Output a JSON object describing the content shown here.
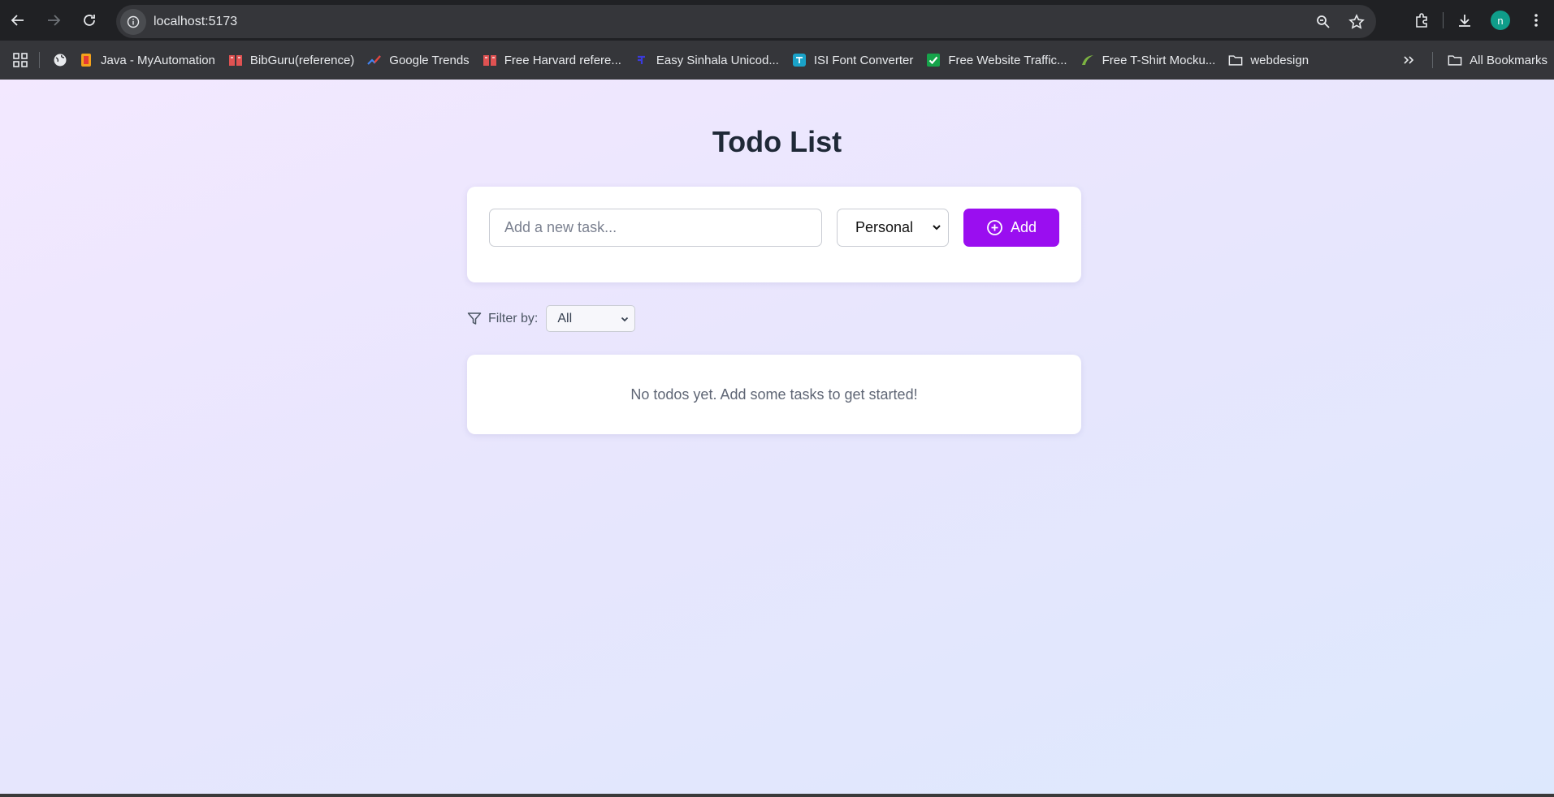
{
  "browser": {
    "url": "localhost:5173",
    "avatar_letter": "n",
    "bookmarks": [
      {
        "label": "Java - MyAutomation",
        "icon": "java-icon"
      },
      {
        "label": "BibGuru(reference)",
        "icon": "book-icon"
      },
      {
        "label": "Google Trends",
        "icon": "trends-icon"
      },
      {
        "label": "Free Harvard refere...",
        "icon": "book-icon"
      },
      {
        "label": "Easy Sinhala Unicod...",
        "icon": "sinhala-icon"
      },
      {
        "label": "ISI Font Converter",
        "icon": "font-converter-icon"
      },
      {
        "label": "Free Website Traffic...",
        "icon": "check-icon"
      },
      {
        "label": "Free T-Shirt Mocku...",
        "icon": "tshirt-icon"
      },
      {
        "label": "webdesign",
        "icon": "folder-icon"
      }
    ],
    "all_bookmarks_label": "All Bookmarks"
  },
  "app": {
    "title": "Todo List",
    "input_placeholder": "Add a new task...",
    "category_value": "Personal",
    "add_label": "Add",
    "filter_label": "Filter by:",
    "filter_value": "All",
    "empty_message": "No todos yet. Add some tasks to get started!"
  },
  "colors": {
    "accent": "#9a0ef0",
    "title": "#1f2937"
  }
}
